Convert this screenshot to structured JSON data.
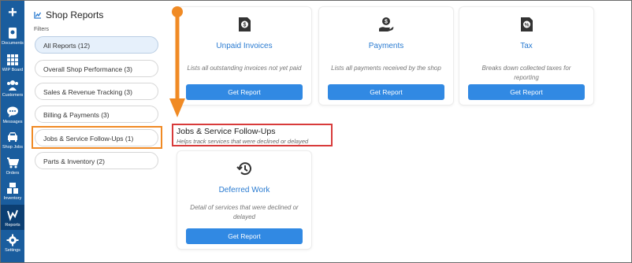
{
  "nav": {
    "items": [
      {
        "id": "add",
        "label": ""
      },
      {
        "id": "documents",
        "label": "Documents"
      },
      {
        "id": "wip",
        "label": "WIP Board"
      },
      {
        "id": "customers",
        "label": "Customers"
      },
      {
        "id": "messages",
        "label": "Messages"
      },
      {
        "id": "shop_jobs",
        "label": "Shop Jobs"
      },
      {
        "id": "orders",
        "label": "Orders"
      },
      {
        "id": "inventory",
        "label": "Inventory"
      },
      {
        "id": "reports",
        "label": "Reports"
      },
      {
        "id": "settings",
        "label": "Settings"
      }
    ],
    "active": "reports",
    "bg_color": "#1a5d9e"
  },
  "sidebar": {
    "title": "Shop Reports",
    "filters_label": "Filters",
    "filters": [
      {
        "label": "All Reports (12)"
      },
      {
        "label": "Overall Shop Performance (3)"
      },
      {
        "label": "Sales & Revenue Tracking (3)"
      },
      {
        "label": "Billing & Payments (3)"
      },
      {
        "label": "Jobs & Service Follow-Ups (1)"
      },
      {
        "label": "Parts & Inventory (2)"
      }
    ]
  },
  "top_cards": [
    {
      "icon": "dollar-document-icon",
      "title": "Unpaid Invoices",
      "desc": "Lists all outstanding invoices not yet paid",
      "button": "Get Report"
    },
    {
      "icon": "payment-hand-icon",
      "title": "Payments",
      "desc": "Lists all payments received by the shop",
      "button": "Get Report"
    },
    {
      "icon": "percent-document-icon",
      "title": "Tax",
      "desc": "Breaks down collected taxes for reporting",
      "button": "Get Report"
    }
  ],
  "section": {
    "title": "Jobs & Service Follow-Ups",
    "subtitle": "Helps track services that were declined or delayed"
  },
  "section_cards": [
    {
      "icon": "history-icon",
      "title": "Deferred Work",
      "desc": "Detail of services that were declined or delayed",
      "button": "Get Report"
    }
  ],
  "colors": {
    "accent": "#3189e3",
    "link": "#2a7bd1",
    "highlight_orange": "#f08a24",
    "highlight_red": "#d83b3b"
  }
}
